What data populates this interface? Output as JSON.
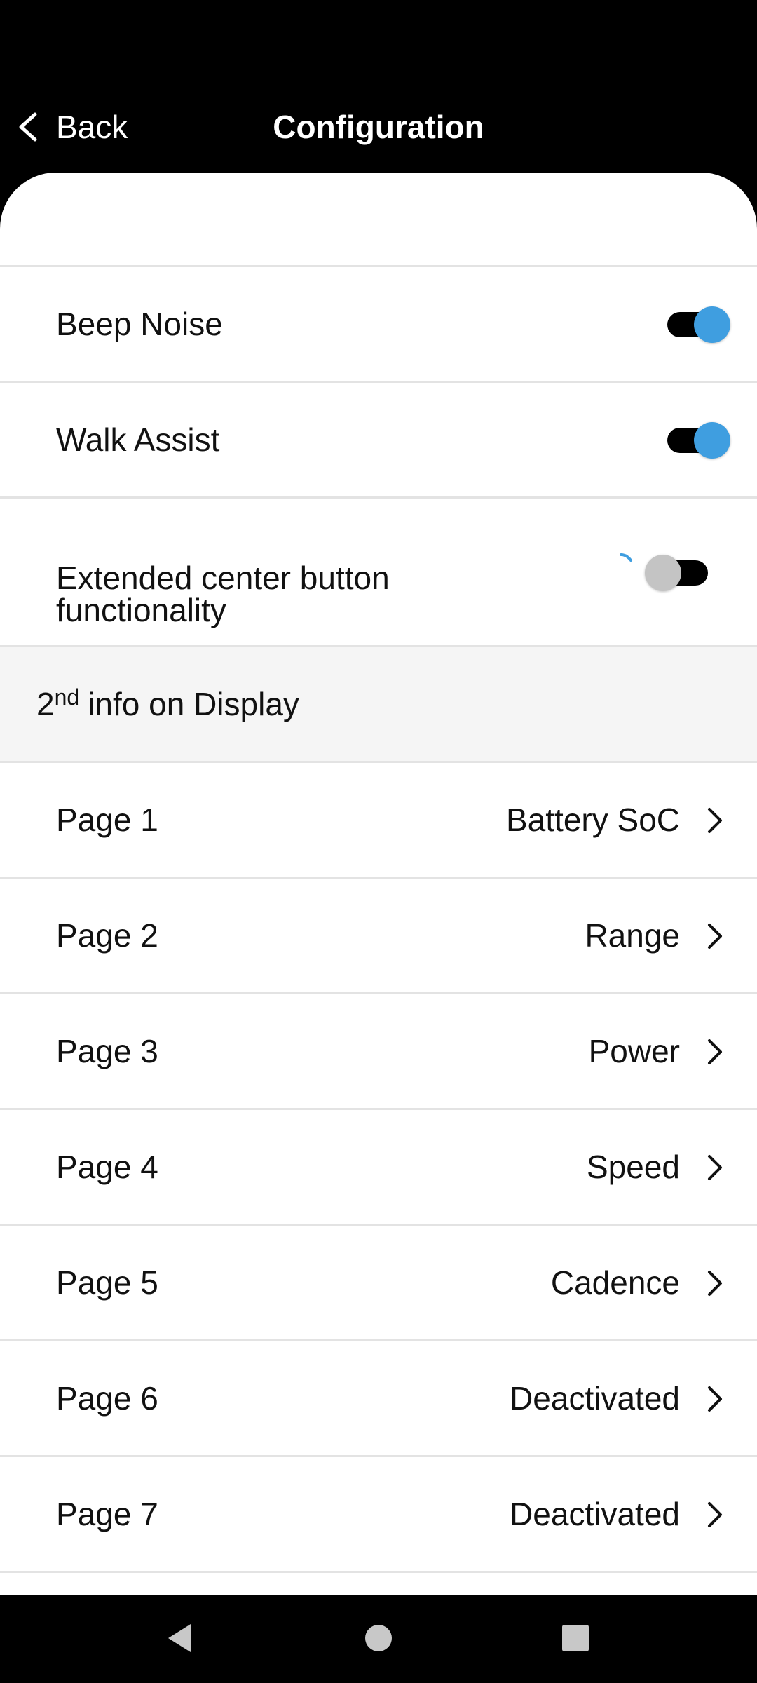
{
  "header": {
    "back_label": "Back",
    "title": "Configuration"
  },
  "toggles": [
    {
      "label": "Beep Noise",
      "on": true
    },
    {
      "label": "Walk Assist",
      "on": true
    },
    {
      "label": "Extended center button functionality",
      "on": false
    }
  ],
  "section": {
    "base": "2",
    "sup": "nd",
    "rest": "info on Display"
  },
  "pages": [
    {
      "label": "Page 1",
      "value": "Battery SoC"
    },
    {
      "label": "Page 2",
      "value": "Range"
    },
    {
      "label": "Page 3",
      "value": "Power"
    },
    {
      "label": "Page 4",
      "value": "Speed"
    },
    {
      "label": "Page 5",
      "value": "Cadence"
    },
    {
      "label": "Page 6",
      "value": "Deactivated"
    },
    {
      "label": "Page 7",
      "value": "Deactivated"
    }
  ],
  "colors": {
    "accent": "#3f9ee0",
    "toggle_track": "#000000",
    "toggle_off_knob": "#c4c4c4",
    "section_bg": "#f5f5f5",
    "divider": "#e3e3e3"
  },
  "icons": {
    "back": "chevron-left-icon",
    "row_chevron": "chevron-right-icon",
    "system_back": "triangle-back-icon",
    "system_home": "circle-home-icon",
    "system_recents": "square-recents-icon"
  }
}
